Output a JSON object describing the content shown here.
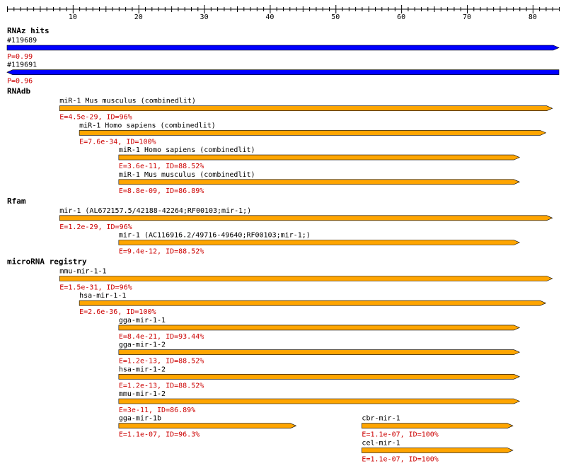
{
  "colors": {
    "rnaz": "#0000ff",
    "hit": "#ffa500",
    "stat": "#cc0000",
    "text": "#000000"
  },
  "ruler": {
    "min": 0,
    "max": 84,
    "tick_labels": [
      "10",
      "20",
      "30",
      "40",
      "50",
      "60",
      "70",
      "80"
    ]
  },
  "sections": [
    {
      "title": "RNAz hits",
      "color": "rnaz",
      "tracks": [
        {
          "label": "#119689",
          "stat": "P=0.99",
          "start": 0,
          "end": 84,
          "strand": "+"
        },
        {
          "label": "#119691",
          "stat": "P=0.96",
          "start": 0,
          "end": 84,
          "strand": "-"
        }
      ]
    },
    {
      "title": "RNAdb",
      "color": "hit",
      "tracks": [
        {
          "label": "miR-1 Mus musculus (combinedlit)",
          "stat": "E=4.5e-29, ID=96%",
          "start": 8,
          "end": 83,
          "strand": "+"
        },
        {
          "label": "miR-1 Homo sapiens (combinedlit)",
          "stat": "E=7.6e-34, ID=100%",
          "start": 11,
          "end": 82,
          "strand": "+"
        },
        {
          "label": "miR-1 Homo sapiens (combinedlit)",
          "stat": "E=3.6e-11, ID=88.52%",
          "start": 17,
          "end": 78,
          "strand": "+"
        },
        {
          "label": "miR-1 Mus musculus (combinedlit)",
          "stat": "E=8.8e-09, ID=86.89%",
          "start": 17,
          "end": 78,
          "strand": "+"
        }
      ]
    },
    {
      "title": "Rfam",
      "color": "hit",
      "tracks": [
        {
          "label": "mir-1 (AL672157.5/42188-42264;RF00103;mir-1;)",
          "stat": "E=1.2e-29, ID=96%",
          "start": 8,
          "end": 83,
          "strand": "+"
        },
        {
          "label": "mir-1 (AC116916.2/49716-49640;RF00103;mir-1;)",
          "stat": "E=9.4e-12, ID=88.52%",
          "start": 17,
          "end": 78,
          "strand": "+"
        }
      ]
    },
    {
      "title": "microRNA registry",
      "color": "hit",
      "tracks": [
        {
          "label": "mmu-mir-1-1",
          "stat": "E=1.5e-31, ID=96%",
          "start": 8,
          "end": 83,
          "strand": "+"
        },
        {
          "label": "hsa-mir-1-1",
          "stat": "E=2.6e-36, ID=100%",
          "start": 11,
          "end": 82,
          "strand": "+"
        },
        {
          "label": "gga-mir-1-1",
          "stat": "E=8.4e-21, ID=93.44%",
          "start": 17,
          "end": 78,
          "strand": "+"
        },
        {
          "label": "gga-mir-1-2",
          "stat": "E=1.2e-13, ID=88.52%",
          "start": 17,
          "end": 78,
          "strand": "+"
        },
        {
          "label": "hsa-mir-1-2",
          "stat": "E=1.2e-13, ID=88.52%",
          "start": 17,
          "end": 78,
          "strand": "+"
        },
        {
          "label": "mmu-mir-1-2",
          "stat": "E=3e-11, ID=86.89%",
          "start": 17,
          "end": 78,
          "strand": "+"
        },
        {
          "label": "gga-mir-1b",
          "stat": "E=1.1e-07, ID=96.3%",
          "start": 17,
          "end": 44,
          "strand": "+",
          "group": "pair1",
          "slot": 0
        },
        {
          "label": "cbr-mir-1",
          "stat": "E=1.1e-07, ID=100%",
          "start": 54,
          "end": 77,
          "strand": "+",
          "group": "pair1",
          "slot": 1
        },
        {
          "label": "cel-mir-1",
          "stat": "E=1.1e-07, ID=100%",
          "start": 54,
          "end": 77,
          "strand": "+"
        }
      ]
    }
  ]
}
